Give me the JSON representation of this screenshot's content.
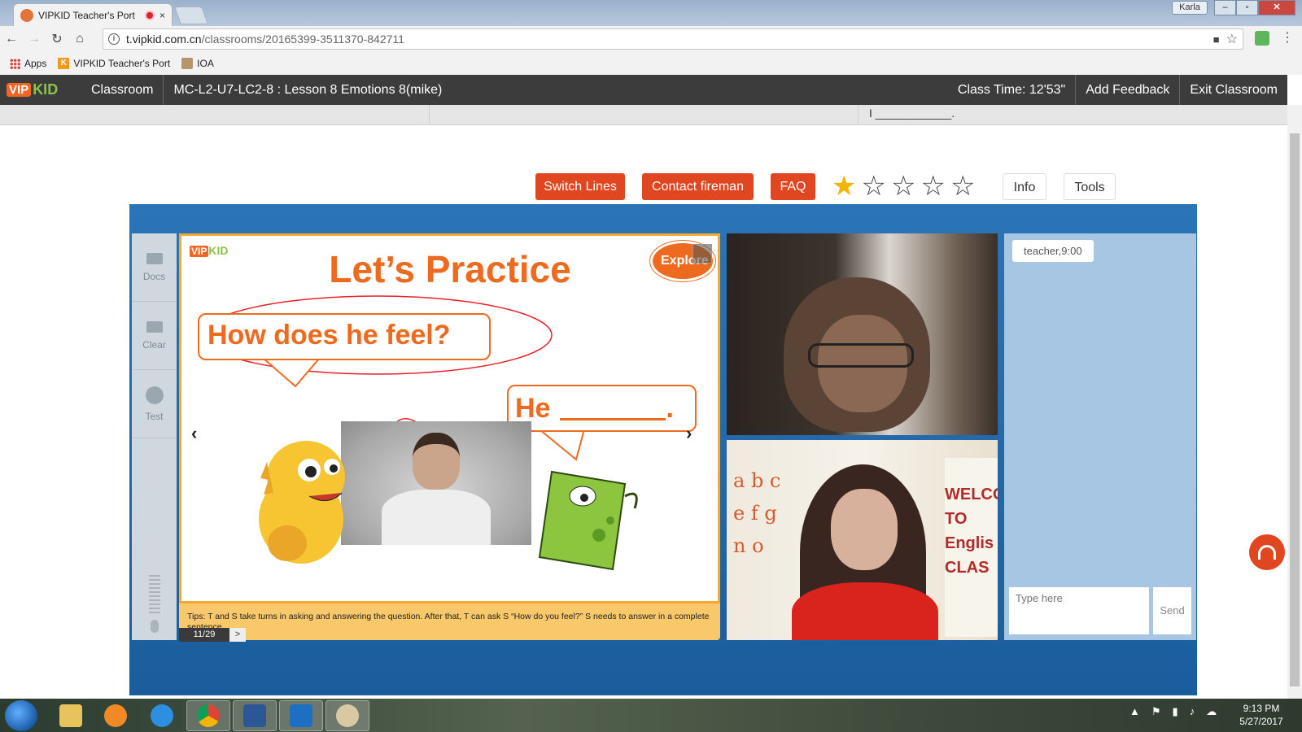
{
  "browser": {
    "tab_title": "VIPKID Teacher's Port",
    "tab_close": "×",
    "user_badge": "Karla",
    "window_buttons": [
      "–",
      "▫",
      "✕"
    ],
    "url_host": "t.vipkid.com.cn",
    "url_path": "/classrooms/20165399-3511370-842711",
    "bookmarks": [
      "Apps",
      "VIPKID Teacher's Port",
      "IOA"
    ]
  },
  "nav": {
    "logo_vip": "VIP",
    "logo_kid": "KID",
    "classroom": "Classroom",
    "lesson": "MC-L2-U7-LC2-8 : Lesson 8 Emotions 8(mike)",
    "class_time": "Class Time: 12'53\"",
    "add_feedback": "Add Feedback",
    "exit": "Exit Classroom"
  },
  "subbar": {
    "text": "I ____________."
  },
  "controls": {
    "switch_lines": "Switch Lines",
    "contact_fireman": "Contact fireman",
    "faq": "FAQ",
    "rating": 1,
    "rating_max": 5,
    "info": "Info",
    "tools": "Tools"
  },
  "sidebar": {
    "docs": "Docs",
    "clear": "Clear",
    "test": "Test"
  },
  "slide": {
    "logo_vip": "VIP",
    "logo_kid": "KID",
    "title": "Let’s Practice",
    "explore": "Explore",
    "question": "How does he feel?",
    "answer_prefix": "He",
    "answer_suffix": ".",
    "prev": "‹",
    "next": "›",
    "tips": "Tips: T and S take turns in asking and answering the question. After that, T can ask S “How do you feel?” S needs to answer in a complete sentence.",
    "page": "11/29",
    "page_next": ">"
  },
  "teacher_video": {
    "letters": "a b c\ne f g\nn o",
    "banner": "WELCO\nTO\nEnglis\nCLAS"
  },
  "chat": {
    "message": "teacher,9:00",
    "placeholder": "Type here",
    "send": "Send"
  },
  "taskbar": {
    "time": "9:13 PM",
    "date": "5/27/2017"
  },
  "colors": {
    "brand_orange": "#ee6a1f",
    "button_red": "#e0461f",
    "stage_blue": "#1b5d9c",
    "chat_blue": "#a6c6e3",
    "star_gold": "#f5b400"
  }
}
